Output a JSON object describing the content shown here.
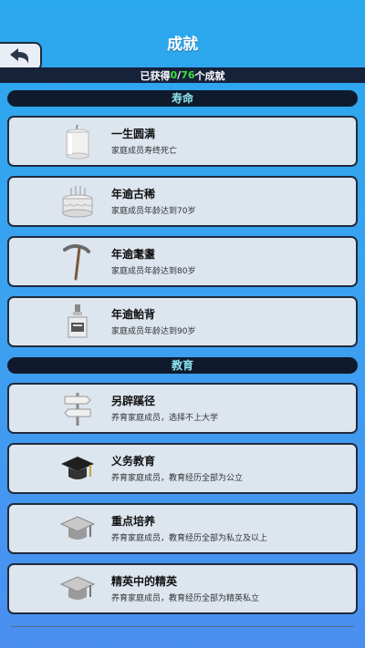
{
  "header": {
    "title": "成就"
  },
  "progress": {
    "prefix": "已获得",
    "current": "0",
    "sep": "/",
    "total": "76",
    "suffix": "个成就"
  },
  "sections": [
    {
      "title": "寿命",
      "items": [
        {
          "name": "一生圆满",
          "desc": "家庭成员寿终死亡",
          "icon": "candle-icon"
        },
        {
          "name": "年逾古稀",
          "desc": "家庭成员年龄达到70岁",
          "icon": "birthday-cake-icon"
        },
        {
          "name": "年逾耄耋",
          "desc": "家庭成员年龄达到80岁",
          "icon": "walking-cane-icon"
        },
        {
          "name": "年逾鲐背",
          "desc": "家庭成员年龄达到90岁",
          "icon": "liquor-bottle-icon"
        }
      ]
    },
    {
      "title": "教育",
      "items": [
        {
          "name": "另辟蹊径",
          "desc": "养育家庭成员，选择不上大学",
          "icon": "signpost-icon"
        },
        {
          "name": "义务教育",
          "desc": "养育家庭成员，教育经历全部为公立",
          "icon": "graduation-cap-icon"
        },
        {
          "name": "重点培养",
          "desc": "养育家庭成员，教育经历全部为私立及以上",
          "icon": "silver-graduation-cap-icon"
        },
        {
          "name": "精英中的精英",
          "desc": "养育家庭成员，教育经历全部为精英私立",
          "icon": "silver-graduation-cap-icon"
        }
      ]
    }
  ],
  "colors": {
    "accent_green": "#37e23b",
    "section_text": "#8fe4f0",
    "card_bg": "#dde5ef"
  }
}
